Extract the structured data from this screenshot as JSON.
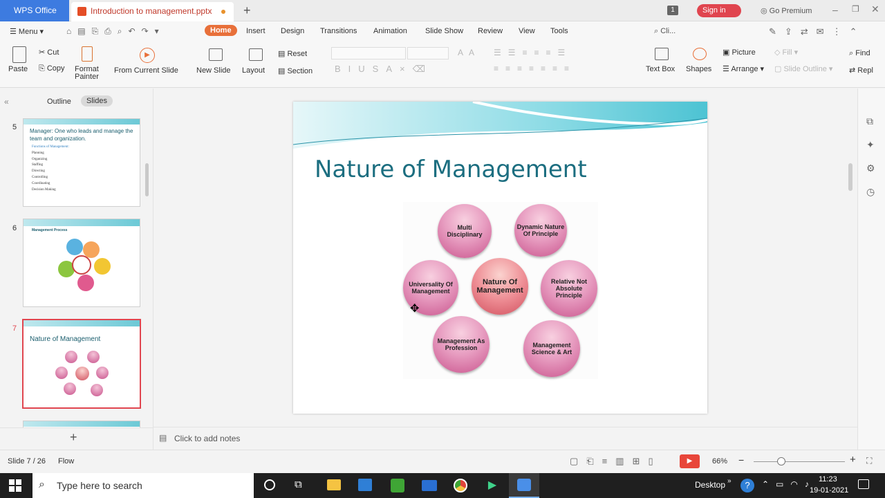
{
  "app": {
    "name": "WPS Office",
    "document_tab": "Introduction to management.pptx",
    "go_premium": "Go Premium",
    "sign_in": "Sign in",
    "window_badge": "1"
  },
  "menu": {
    "menu_label": "Menu",
    "tabs": [
      "Home",
      "Insert",
      "Design",
      "Transitions",
      "Animation",
      "Slide Show",
      "Review",
      "View",
      "Tools"
    ],
    "search": "Cli..."
  },
  "ribbon": {
    "paste": "Paste",
    "cut": "Cut",
    "copy": "Copy",
    "format_painter_1": "Format",
    "format_painter_2": "Painter",
    "from_current_slide": "From Current Slide",
    "new_slide": "New Slide",
    "layout": "Layout",
    "reset": "Reset",
    "section": "Section",
    "text_box": "Text Box",
    "shapes": "Shapes",
    "picture": "Picture",
    "arrange": "Arrange",
    "fill": "Fill",
    "slide_outline": "Slide Outline",
    "find": "Find",
    "replace": "Repl"
  },
  "left_panel": {
    "tabs": [
      "Outline",
      "Slides"
    ],
    "slides": [
      {
        "num": "5",
        "title": "Manager: One who leads and manage the team and organization.",
        "bullets": [
          "Functions of Management:",
          "Planning",
          "Organizing",
          "Staffing",
          "Directing",
          "Controlling",
          "Coordinating",
          "Decision Making"
        ]
      },
      {
        "num": "6",
        "title": "Management Process"
      },
      {
        "num": "7",
        "title": "Nature of Management"
      }
    ]
  },
  "slide": {
    "title": "Nature of Management",
    "center": "Nature Of Management",
    "nodes": [
      "Multi Disciplinary",
      "Dynamic Nature Of Principle",
      "Universality Of Management",
      "Relative Not Absolute Principle",
      "Management As Profession",
      "Management Science & Art"
    ]
  },
  "notes": {
    "placeholder": "Click to add notes"
  },
  "status": {
    "slide_info": "Slide 7 / 26",
    "flow": "Flow",
    "zoom": "66%"
  },
  "taskbar": {
    "search_placeholder": "Type here to search",
    "desktop": "Desktop",
    "time": "11:23",
    "date": "19-01-2021"
  }
}
